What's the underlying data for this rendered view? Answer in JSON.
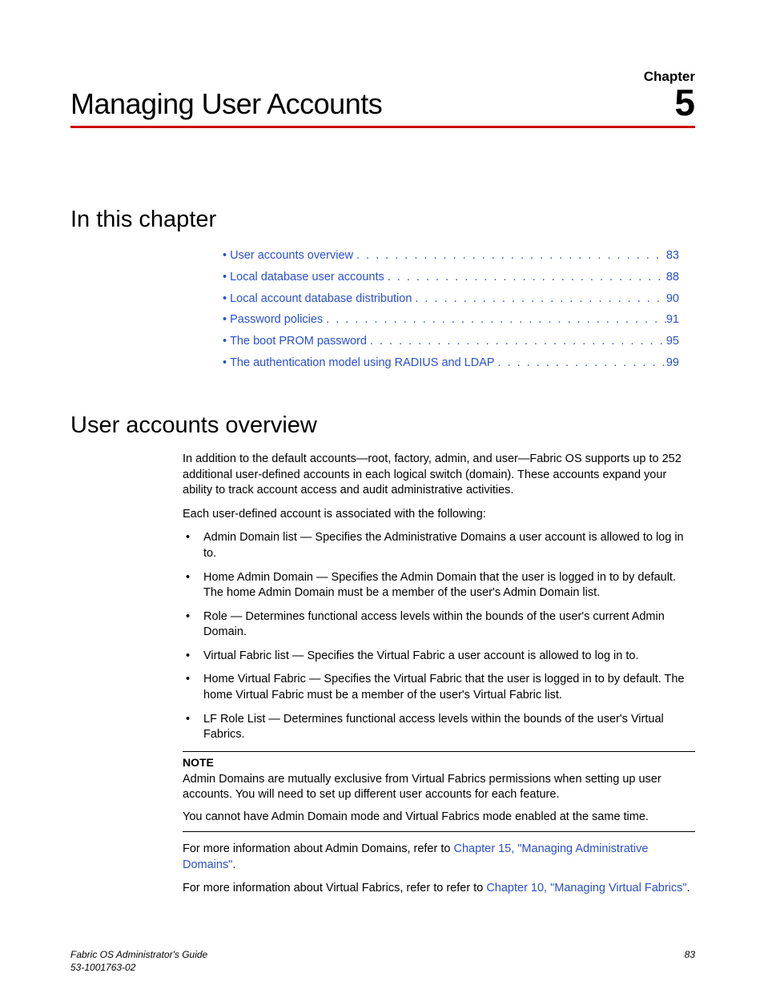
{
  "header": {
    "chapter_label": "Chapter",
    "chapter_title": "Managing User Accounts",
    "chapter_number": "5"
  },
  "toc": {
    "heading": "In this chapter",
    "items": [
      {
        "label": "User accounts overview",
        "page": "83"
      },
      {
        "label": "Local database user accounts",
        "page": "88"
      },
      {
        "label": "Local account database distribution",
        "page": "90"
      },
      {
        "label": "Password policies",
        "page": "91"
      },
      {
        "label": "The boot PROM password",
        "page": "95"
      },
      {
        "label": "The authentication model using RADIUS and LDAP",
        "page": "99"
      }
    ]
  },
  "overview": {
    "heading": "User accounts overview",
    "intro": "In addition to the default accounts—root, factory, admin, and user—Fabric OS supports up to 252 additional user-defined accounts in each logical switch (domain). These accounts expand your ability to track account access and audit administrative activities.",
    "assoc_lead": "Each user-defined account is associated with the following:",
    "bullets": [
      "Admin Domain list — Specifies the Administrative Domains a user account is allowed to log in to.",
      "Home Admin Domain — Specifies the Admin Domain that the user is logged in to by default. The home Admin Domain must be a member of the user's Admin Domain list.",
      "Role — Determines functional access levels within the bounds of the user's current Admin Domain.",
      "Virtual Fabric list — Specifies the Virtual Fabric a user account is allowed to log in to.",
      "Home Virtual Fabric — Specifies the Virtual Fabric that the user is logged in to by default. The home Virtual Fabric must be a member of the user's Virtual Fabric list.",
      "LF Role List — Determines functional access levels within the bounds of the user's Virtual Fabrics."
    ],
    "note_label": "NOTE",
    "note_body": "Admin Domains are mutually exclusive from Virtual Fabrics permissions when setting up user accounts. You will need to set up different user accounts for each feature.",
    "note_extra": "You cannot have Admin Domain mode and Virtual Fabrics mode enabled at the same time.",
    "ref1_pre": "For more information about Admin Domains, refer to ",
    "ref1_link": "Chapter 15, \"Managing Administrative Domains\"",
    "ref1_post": ".",
    "ref2_pre": "For more information about Virtual Fabrics, refer to refer to ",
    "ref2_link": "Chapter 10, \"Managing Virtual Fabrics\"",
    "ref2_post": "."
  },
  "footer": {
    "title": "Fabric OS Administrator's Guide",
    "docnum": "53-1001763-02",
    "pagenum": "83"
  }
}
